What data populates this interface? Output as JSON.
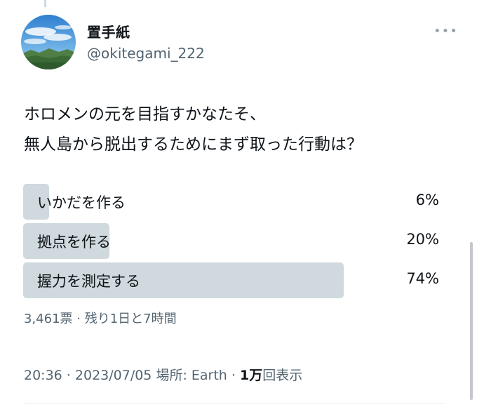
{
  "user": {
    "display_name": "置手紙",
    "handle": "@okitegami_222",
    "avatar": "landscape-avatar-icon"
  },
  "more_icon": "more-options-icon",
  "tweet": {
    "lines": [
      "ホロメンの元を目指すかなたそ、",
      "無人島から脱出するためにまず取った行動は？"
    ]
  },
  "poll": {
    "options": [
      {
        "label": "いかだを作る",
        "percent_text": "6%",
        "percent": 6
      },
      {
        "label": "拠点を作る",
        "percent_text": "20%",
        "percent": 20
      },
      {
        "label": "握力を測定する",
        "percent_text": "74%",
        "percent": 74
      }
    ],
    "meta": "3,461票 · 残り1日と7時間",
    "bar_color": "#cfd9de"
  },
  "footer": {
    "time": "20:36",
    "sep1": " · ",
    "date": "2023/07/05",
    "place": " 場所: Earth",
    "sep2": " · ",
    "views_count": "1万",
    "views_label": "回表示"
  }
}
